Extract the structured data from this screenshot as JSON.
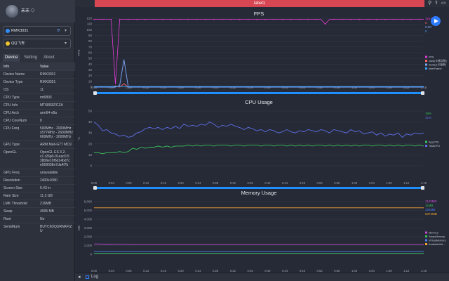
{
  "user": {
    "name": "禾禾 ◇"
  },
  "device_select": {
    "value": "RMX3031"
  },
  "app_select": {
    "value": "QQ飞车"
  },
  "tabs": [
    "Device",
    "Setting",
    "About"
  ],
  "table": {
    "headers": [
      "Info",
      "Value"
    ],
    "rows": [
      [
        "Device Name",
        "RMX3031"
      ],
      [
        "Device Type",
        "RMX3031"
      ],
      [
        "OS",
        "11"
      ],
      [
        "CPU Type",
        "mt6893"
      ],
      [
        "CPU Info",
        "MT6893Z/CZA"
      ],
      [
        "CPU Arch",
        "arm64-v8a"
      ],
      [
        "CPU CoreNum",
        "8"
      ],
      [
        "CPU Freq",
        "500MHz - 2000MHz\nx577MHz - 2600MHz\n669MHz - 3000MHz"
      ],
      [
        "GPU Type",
        "ARM Mali-G77 MC9"
      ],
      [
        "OpenGL",
        "OpenGL ES 3.2-\nv1.r26p0-01eac0.5\n3806e10f6d14bd7c\ne569038e7da4f7b"
      ],
      [
        "GPU Freq",
        "unavailable"
      ],
      [
        "Resolution",
        "2400x1080"
      ],
      [
        "Screen Size",
        "6.43 in"
      ],
      [
        "Ram Size",
        "11.3 GB"
      ],
      [
        "LMK Threshold",
        "216MB"
      ],
      [
        "Swap",
        "4095 MB"
      ],
      [
        "Root",
        "No"
      ],
      [
        "SerialNum",
        "BUTC6DQURNKFIZ\nU"
      ]
    ]
  },
  "topbar": {
    "scene_tab": "SceneTab",
    "label": "label1"
  },
  "bottombar": {
    "log_label": "Log"
  },
  "colors": {
    "accent": "#2e7bff",
    "label_bar": "#d84654",
    "fps": "#e23bd6",
    "cpu_app": "#3bbf5a",
    "cpu_total": "#5d6fe8",
    "mem": "#c84cd8",
    "mem_avail": "#f2a52c",
    "timeline": "#1f8fff"
  },
  "icons": [
    "settings-icon",
    "gear-icon",
    "pin-icon",
    "share-icon",
    "folder-icon",
    "play-icon",
    "log-icon"
  ],
  "chart_data": [
    {
      "type": "line",
      "title": "FPS",
      "ylabel": "FPS",
      "ylim": [
        0,
        120
      ],
      "yticks": [
        "0",
        "10",
        "20",
        "30",
        "40",
        "50",
        "60",
        "70",
        "80",
        "90",
        "100",
        "110",
        "120"
      ],
      "x": [
        "0:00",
        "0:04",
        "0:08",
        "0:12",
        "0:16",
        "0:20",
        "0:24",
        "0:28",
        "0:32",
        "0:36",
        "0:40",
        "0:44",
        "0:48",
        "0:52",
        "0:56",
        "1:00",
        "1:04",
        "1:08",
        "1:12",
        "1:16"
      ],
      "series": [
        {
          "name": "FPS",
          "values": [
            118,
            118,
            118,
            118,
            118,
            5,
            118,
            118,
            118,
            118,
            118,
            118,
            118,
            118,
            118,
            118,
            118,
            118,
            118,
            118,
            118,
            118,
            118,
            118,
            118,
            118,
            118,
            118,
            118,
            118,
            118,
            118,
            118,
            118,
            118,
            118,
            118,
            118,
            118,
            118,
            118,
            118,
            118,
            118,
            118,
            118,
            118,
            118,
            118,
            118,
            118,
            118,
            118,
            118,
            110,
            118,
            118,
            118,
            118,
            118,
            118,
            118,
            118,
            118,
            118,
            118,
            118,
            118,
            118,
            118,
            118,
            118,
            118,
            118,
            118,
            118,
            118,
            118
          ]
        },
        {
          "name": "Jank",
          "values": [
            0,
            0,
            0,
            0,
            0,
            2,
            0,
            6,
            0,
            0,
            0,
            0,
            0,
            0,
            0,
            0,
            0,
            0,
            0,
            0,
            0,
            0,
            0,
            0,
            0,
            0,
            0,
            0,
            0,
            0,
            0,
            0,
            0,
            0,
            0,
            0,
            0,
            0,
            0,
            0,
            0,
            0,
            0,
            0,
            0,
            0,
            0,
            0,
            0,
            0,
            0,
            0,
            0,
            0,
            0,
            0,
            0,
            0,
            0,
            0,
            0,
            0,
            0,
            0,
            0,
            0,
            0,
            0,
            0,
            0,
            0,
            0,
            0,
            0,
            0,
            0,
            0,
            0
          ]
        },
        {
          "name": "Stutter",
          "values": [
            0,
            0,
            0,
            0,
            0,
            0,
            3,
            48,
            0,
            0,
            0,
            0,
            0,
            0,
            0,
            0,
            0,
            0,
            0,
            0,
            0,
            0,
            0,
            0,
            0,
            0,
            0,
            0,
            0,
            0,
            0,
            0,
            0,
            0,
            0,
            0,
            0,
            0,
            0,
            0,
            0,
            0,
            0,
            0,
            0,
            0,
            0,
            0,
            0,
            0,
            0,
            0,
            0,
            0,
            0,
            0,
            0,
            0,
            0,
            0,
            0,
            0,
            0,
            0,
            0,
            0,
            0,
            0,
            0,
            0,
            0,
            0,
            0,
            0,
            0,
            0,
            0,
            0
          ]
        },
        {
          "name": "InterFrame",
          "values": [
            1,
            1,
            1,
            1,
            1,
            1,
            1,
            1,
            1,
            1,
            1,
            1,
            1,
            1,
            1,
            1,
            1,
            1,
            1,
            1,
            1,
            1,
            1,
            1,
            1,
            1,
            1,
            1,
            1,
            1,
            1,
            1,
            1,
            1,
            1,
            1,
            1,
            1,
            1,
            1,
            1,
            1,
            1,
            1,
            1,
            1,
            1,
            1,
            1,
            1,
            1,
            1,
            1,
            1,
            1,
            1,
            1,
            1,
            1,
            1,
            1,
            1,
            1,
            1,
            1,
            1,
            1,
            1,
            1,
            1,
            1,
            1,
            1,
            1,
            1,
            1,
            1,
            1
          ]
        }
      ],
      "legend": [
        "FPS",
        "Jank(卡顿次数)",
        "Stutter(卡顿率)",
        "InterFrame"
      ],
      "current": [
        "119.0",
        "0",
        "0.00",
        "0"
      ]
    },
    {
      "type": "line",
      "title": "CPU Usage",
      "ylabel": "%",
      "ylim": [
        0,
        50
      ],
      "yticks": [
        "0",
        "10",
        "20",
        "30",
        "40",
        "50"
      ],
      "x": [
        "0:00",
        "0:04",
        "0:08",
        "0:12",
        "0:16",
        "0:20",
        "0:24",
        "0:28",
        "0:32",
        "0:36",
        "0:40",
        "0:44",
        "0:48",
        "0:52",
        "0:56",
        "1:00",
        "1:04",
        "1:08",
        "1:12",
        "1:16"
      ],
      "series": [
        {
          "name": "AppCPU",
          "values": [
            12,
            12,
            11,
            12,
            12,
            12,
            13,
            12,
            13,
            16,
            15,
            17,
            16,
            17,
            17,
            18,
            17,
            18,
            17,
            18,
            18,
            18,
            19,
            18,
            19,
            18,
            19,
            19,
            18,
            19,
            19,
            19,
            18,
            19,
            19,
            18,
            19,
            19,
            19,
            18,
            19,
            19,
            18,
            19,
            19,
            18,
            19,
            18,
            19,
            18,
            19,
            18,
            19,
            19,
            18,
            19,
            18,
            19,
            18,
            19,
            18,
            19,
            18,
            19,
            19,
            18,
            19,
            19,
            18,
            19,
            18,
            19,
            18,
            19,
            19,
            18,
            19,
            18
          ]
        },
        {
          "name": "TotalCPU",
          "values": [
            40,
            37,
            32,
            33,
            30,
            29,
            27,
            28,
            26,
            27,
            30,
            31,
            34,
            35,
            34,
            35,
            33,
            35,
            34,
            36,
            34,
            38,
            36,
            37,
            36,
            38,
            37,
            40,
            38,
            35,
            37,
            36,
            38,
            36,
            35,
            33,
            35,
            34,
            32,
            33,
            31,
            33,
            32,
            30,
            31,
            33,
            31,
            30,
            32,
            31,
            33,
            32,
            31,
            33,
            32,
            30,
            33,
            32,
            31,
            30,
            33,
            31,
            32,
            29,
            30,
            31,
            28,
            30,
            27,
            29,
            28,
            30,
            26,
            29,
            28,
            30,
            29,
            30
          ]
        }
      ],
      "legend": [
        "AppCPU",
        "TotalCPU"
      ],
      "current": [
        "19%",
        "31%"
      ]
    },
    {
      "type": "line",
      "title": "Memory Usage",
      "ylabel": "MB",
      "ylim": [
        0,
        6000
      ],
      "yticks": [
        "0",
        "1,000",
        "2,000",
        "3,000",
        "4,000",
        "5,000",
        "6,000"
      ],
      "x": [
        "0:00",
        "0:04",
        "0:08",
        "0:12",
        "0:16",
        "0:20",
        "0:24",
        "0:28",
        "0:32",
        "0:36",
        "0:40",
        "0:44",
        "0:48",
        "0:52",
        "0:56",
        "1:00",
        "1:04",
        "1:08",
        "1:12",
        "1:16"
      ],
      "series": [
        {
          "name": "Memory",
          "values": [
            1180,
            1180,
            1170,
            1160,
            1160,
            1150,
            1150,
            1140,
            1140,
            1130,
            1130,
            1130,
            1130,
            1130,
            1130,
            1130,
            1130,
            1130,
            1130,
            1130,
            1130,
            1130,
            1130,
            1130,
            1130,
            1130,
            1130,
            1130,
            1130,
            1130,
            1130,
            1130,
            1130,
            1130,
            1130,
            1130,
            1130,
            1130,
            1130,
            1130,
            1130,
            1130,
            1130,
            1130,
            1130,
            1130,
            1130,
            1130,
            1130,
            1130,
            1130,
            1130,
            1130,
            1130,
            1130,
            1130,
            1130,
            1130,
            1130,
            1130,
            1130,
            1130,
            1130,
            1130,
            1130,
            1130,
            1130,
            1130,
            1130,
            1130,
            1130,
            1130,
            1130,
            1130,
            1130,
            1130,
            1130,
            1130
          ]
        },
        {
          "name": "SwapMemory",
          "values": [
            110,
            110,
            110,
            110,
            110,
            110,
            110,
            110,
            110,
            110,
            110,
            110,
            110,
            110,
            110,
            110,
            110,
            110,
            110,
            110,
            110,
            110,
            110,
            110,
            110,
            110,
            110,
            110,
            110,
            110,
            110,
            110,
            110,
            110,
            110,
            110,
            110,
            110,
            110,
            110,
            110,
            110,
            110,
            110,
            110,
            110,
            110,
            110,
            110,
            110,
            110,
            110,
            110,
            110,
            110,
            110,
            110,
            110,
            110,
            110,
            110,
            110,
            110,
            110,
            110,
            110,
            110,
            110,
            110,
            110,
            110,
            110,
            110,
            110,
            110,
            110,
            110,
            110
          ]
        },
        {
          "name": "VirtualMemory",
          "values": [
            330,
            330,
            330,
            330,
            330,
            330,
            330,
            330,
            330,
            330,
            330,
            330,
            330,
            330,
            330,
            330,
            330,
            330,
            330,
            330,
            330,
            330,
            330,
            330,
            330,
            330,
            330,
            330,
            330,
            330,
            330,
            330,
            330,
            330,
            330,
            330,
            330,
            330,
            330,
            330,
            330,
            330,
            330,
            330,
            330,
            330,
            330,
            330,
            330,
            330,
            330,
            330,
            330,
            330,
            330,
            330,
            330,
            330,
            330,
            330,
            330,
            330,
            330,
            330,
            330,
            330,
            330,
            330,
            330,
            330,
            330,
            330,
            330,
            330,
            330,
            330,
            330,
            330
          ]
        },
        {
          "name": "AvailableMemory",
          "values": [
            5300,
            5300,
            5300,
            5300,
            5300,
            5300,
            5300,
            5300,
            5300,
            5300,
            5300,
            5300,
            5300,
            5300,
            5300,
            5300,
            5300,
            5300,
            5300,
            5300,
            5300,
            5300,
            5300,
            5300,
            5300,
            5300,
            5300,
            5300,
            5300,
            5300,
            5300,
            5300,
            5300,
            5300,
            5300,
            5300,
            5300,
            5300,
            5300,
            5300,
            5300,
            5300,
            5300,
            5300,
            5300,
            5300,
            5300,
            5300,
            5300,
            5300,
            5300,
            5300,
            5300,
            5300,
            5300,
            5300,
            5300,
            5300,
            5300,
            5300,
            5300,
            5300,
            5300,
            5300,
            5300,
            5300,
            5300,
            5300,
            5300,
            5300,
            5300,
            5300,
            5300,
            5300,
            5300,
            5300,
            5300,
            5300
          ]
        }
      ],
      "legend": [
        "Memory",
        "SwapMemory",
        "VirtualMemory",
        "AvailableMe..."
      ],
      "current": [
        "1123MB",
        "11MB",
        "334MB",
        "5374MB"
      ]
    }
  ]
}
